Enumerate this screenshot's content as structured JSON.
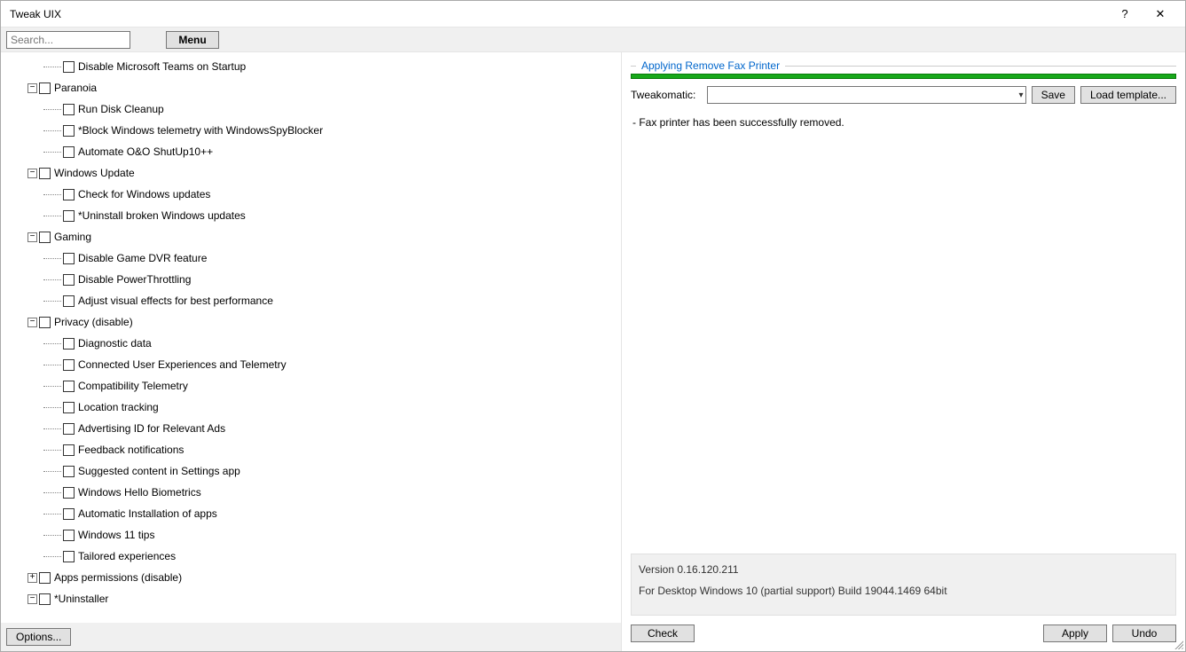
{
  "window": {
    "title": "Tweak UIX"
  },
  "toolbar": {
    "search_placeholder": "Search...",
    "menu_label": "Menu"
  },
  "tree": [
    {
      "depth": 2,
      "expander": null,
      "checkbox": true,
      "label": "Disable Microsoft Teams on Startup"
    },
    {
      "depth": 1,
      "expander": "-",
      "checkbox": true,
      "label": "Paranoia"
    },
    {
      "depth": 2,
      "expander": null,
      "checkbox": true,
      "label": "Run Disk Cleanup"
    },
    {
      "depth": 2,
      "expander": null,
      "checkbox": true,
      "label": "*Block Windows telemetry with WindowsSpyBlocker"
    },
    {
      "depth": 2,
      "expander": null,
      "checkbox": true,
      "label": "Automate O&O ShutUp10++"
    },
    {
      "depth": 1,
      "expander": "-",
      "checkbox": true,
      "label": "Windows Update"
    },
    {
      "depth": 2,
      "expander": null,
      "checkbox": true,
      "label": "Check for Windows updates"
    },
    {
      "depth": 2,
      "expander": null,
      "checkbox": true,
      "label": "*Uninstall broken Windows updates"
    },
    {
      "depth": 1,
      "expander": "-",
      "checkbox": true,
      "label": "Gaming"
    },
    {
      "depth": 2,
      "expander": null,
      "checkbox": true,
      "label": "Disable Game DVR feature"
    },
    {
      "depth": 2,
      "expander": null,
      "checkbox": true,
      "label": "Disable PowerThrottling"
    },
    {
      "depth": 2,
      "expander": null,
      "checkbox": true,
      "label": "Adjust visual effects for best performance"
    },
    {
      "depth": 1,
      "expander": "-",
      "checkbox": true,
      "label": "Privacy (disable)"
    },
    {
      "depth": 2,
      "expander": null,
      "checkbox": true,
      "label": "Diagnostic data"
    },
    {
      "depth": 2,
      "expander": null,
      "checkbox": true,
      "label": "Connected User Experiences and Telemetry"
    },
    {
      "depth": 2,
      "expander": null,
      "checkbox": true,
      "label": "Compatibility Telemetry"
    },
    {
      "depth": 2,
      "expander": null,
      "checkbox": true,
      "label": "Location tracking"
    },
    {
      "depth": 2,
      "expander": null,
      "checkbox": true,
      "label": "Advertising ID for Relevant Ads"
    },
    {
      "depth": 2,
      "expander": null,
      "checkbox": true,
      "label": "Feedback notifications"
    },
    {
      "depth": 2,
      "expander": null,
      "checkbox": true,
      "label": "Suggested content in Settings app"
    },
    {
      "depth": 2,
      "expander": null,
      "checkbox": true,
      "label": "Windows Hello Biometrics"
    },
    {
      "depth": 2,
      "expander": null,
      "checkbox": true,
      "label": "Automatic Installation of apps"
    },
    {
      "depth": 2,
      "expander": null,
      "checkbox": true,
      "label": "Windows 11 tips"
    },
    {
      "depth": 2,
      "expander": null,
      "checkbox": true,
      "label": "Tailored experiences"
    },
    {
      "depth": 1,
      "expander": "+",
      "checkbox": true,
      "label": "Apps permissions (disable)"
    },
    {
      "depth": 1,
      "expander": "-",
      "checkbox": true,
      "label": "*Uninstaller"
    }
  ],
  "left_footer": {
    "options_label": "Options..."
  },
  "right": {
    "group_title": "Applying Remove Fax Printer",
    "tweakomatic_label": "Tweakomatic:",
    "save_label": "Save",
    "load_label": "Load template...",
    "log_line": "- Fax printer has been successfully removed.",
    "info_version": "Version 0.16.120.211",
    "info_os": "For Desktop Windows 10 (partial support) Build 19044.1469 64bit",
    "check_label": "Check",
    "apply_label": "Apply",
    "undo_label": "Undo"
  }
}
